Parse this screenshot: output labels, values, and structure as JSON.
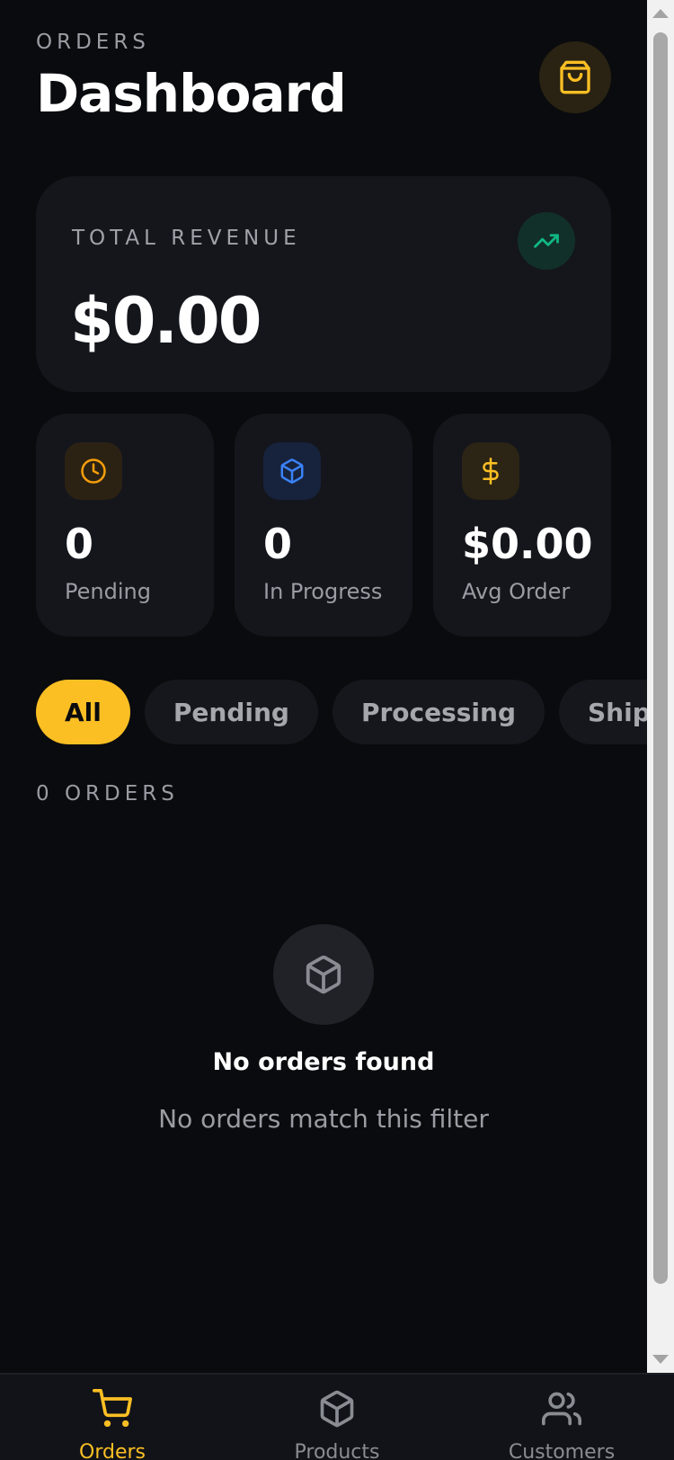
{
  "header": {
    "eyebrow": "ORDERS",
    "title": "Dashboard",
    "action_icon": "shopping-bag-icon"
  },
  "revenue": {
    "label": "TOTAL REVENUE",
    "value": "$0.00",
    "icon": "trending-up-icon"
  },
  "stats": [
    {
      "value": "0",
      "label": "Pending",
      "icon": "clock-icon",
      "color": "#f59e0b"
    },
    {
      "value": "0",
      "label": "In Progress",
      "icon": "box-icon",
      "color": "#3b82f6"
    },
    {
      "value": "$0.00",
      "label": "Avg Order",
      "icon": "dollar-icon",
      "color": "#fbbf24"
    }
  ],
  "filters": {
    "items": [
      "All",
      "Pending",
      "Processing",
      "Shipped"
    ],
    "selected": "All"
  },
  "orders_count": "0 ORDERS",
  "empty_state": {
    "icon": "box-icon",
    "title": "No orders found",
    "subtitle": "No orders match this filter"
  },
  "bottom_nav": {
    "items": [
      {
        "label": "Orders",
        "icon": "cart-icon",
        "active": true
      },
      {
        "label": "Products",
        "icon": "box-icon",
        "active": false
      },
      {
        "label": "Customers",
        "icon": "users-icon",
        "active": false
      }
    ]
  },
  "colors": {
    "background": "#0a0b0e",
    "card": "#14161c",
    "accent": "#fbbf24",
    "success": "#10b981",
    "muted": "#9a9ca3"
  }
}
